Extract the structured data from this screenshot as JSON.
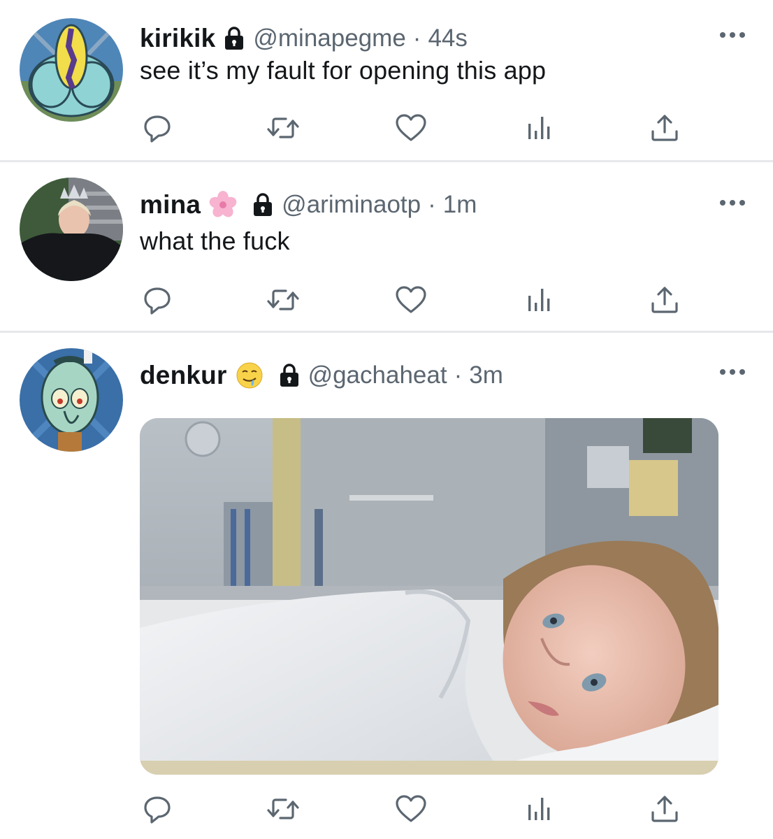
{
  "tweets": [
    {
      "name": "kirikik",
      "name_emoji": "",
      "handle": "@minapegme",
      "separator": "·",
      "time": "44s",
      "text": "see it’s my fault for opening this app"
    },
    {
      "name": "mina",
      "name_emoji": "cherry-blossom",
      "handle": "@ariminaotp",
      "separator": "·",
      "time": "1m",
      "text": "what the fuck"
    },
    {
      "name": "denkur",
      "name_emoji": "drooling-face",
      "handle": "@gachaheat",
      "separator": "·",
      "time": "3m",
      "text": "",
      "media": "photo"
    }
  ],
  "icons": {
    "reply": "reply-icon",
    "retweet": "retweet-icon",
    "like": "heart-icon",
    "analytics": "analytics-icon",
    "share": "share-icon",
    "lock": "lock-icon",
    "more": "more-icon"
  },
  "colors": {
    "text": "#14171a",
    "secondary": "#5b6670",
    "divider": "#e6e8eb"
  }
}
